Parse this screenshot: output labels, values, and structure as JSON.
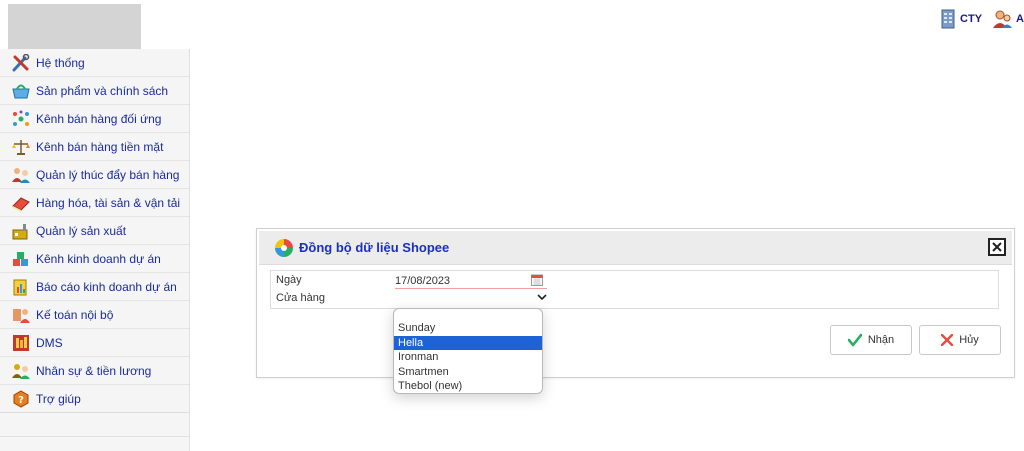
{
  "header": {
    "company_label": "CTY",
    "user_label": "A"
  },
  "sidebar": {
    "items": [
      {
        "label": "Hệ thống",
        "icon": "tools-icon"
      },
      {
        "label": "Sản phẩm và chính sách",
        "icon": "basket-icon"
      },
      {
        "label": "Kênh bán hàng đối ứng",
        "icon": "network-icon"
      },
      {
        "label": "Kênh bán hàng tiền mặt",
        "icon": "scale-icon"
      },
      {
        "label": "Quản lý thúc đẩy bán hàng",
        "icon": "people-icon"
      },
      {
        "label": "Hàng hóa, tài sản & vận tải",
        "icon": "books-icon"
      },
      {
        "label": "Quản lý sản xuất",
        "icon": "factory-icon"
      },
      {
        "label": "Kênh kinh doanh dự án",
        "icon": "blocks-icon"
      },
      {
        "label": "Báo cáo kinh doanh dự án",
        "icon": "report-icon"
      },
      {
        "label": "Kế toán nội bộ",
        "icon": "accountant-icon"
      },
      {
        "label": "DMS",
        "icon": "dms-icon"
      },
      {
        "label": "Nhân sự & tiền lương",
        "icon": "staff-icon"
      },
      {
        "label": "Trợ giúp",
        "icon": "help-icon"
      }
    ]
  },
  "dialog": {
    "title": "Đồng bộ dữ liệu Shopee",
    "date_label": "Ngày",
    "date_value": "17/08/2023",
    "store_label": "Cửa hàng",
    "ok_label": "Nhận",
    "cancel_label": "Hủy"
  },
  "store_dropdown": {
    "options": [
      "Sunday",
      "Hella",
      "Ironman",
      "Smartmen",
      "Thebol (new)"
    ],
    "selected": "Hella"
  },
  "colors": {
    "title_blue": "#1a2fc4",
    "menu_blue": "#1a2b9c",
    "selected_option": "#1e63d6"
  }
}
